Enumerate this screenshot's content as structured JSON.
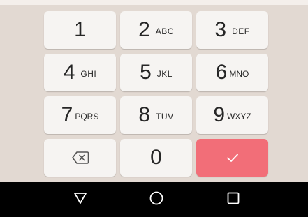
{
  "keypad": {
    "keys": [
      {
        "digit": "1",
        "letters": ""
      },
      {
        "digit": "2",
        "letters": "ABC"
      },
      {
        "digit": "3",
        "letters": "DEF"
      },
      {
        "digit": "4",
        "letters": "GHI"
      },
      {
        "digit": "5",
        "letters": "JKL"
      },
      {
        "digit": "6",
        "letters": "MNO"
      },
      {
        "digit": "7",
        "letters": "PQRS"
      },
      {
        "digit": "8",
        "letters": "TUV"
      },
      {
        "digit": "9",
        "letters": "WXYZ"
      }
    ],
    "zero": "0",
    "backspace_icon": "backspace-icon",
    "confirm_icon": "checkmark-icon",
    "confirm_color": "#f26e78",
    "background_color": "#e2d9d2"
  },
  "navbar": {
    "back_icon": "back-triangle-icon",
    "home_icon": "home-circle-icon",
    "recents_icon": "recents-square-icon"
  }
}
